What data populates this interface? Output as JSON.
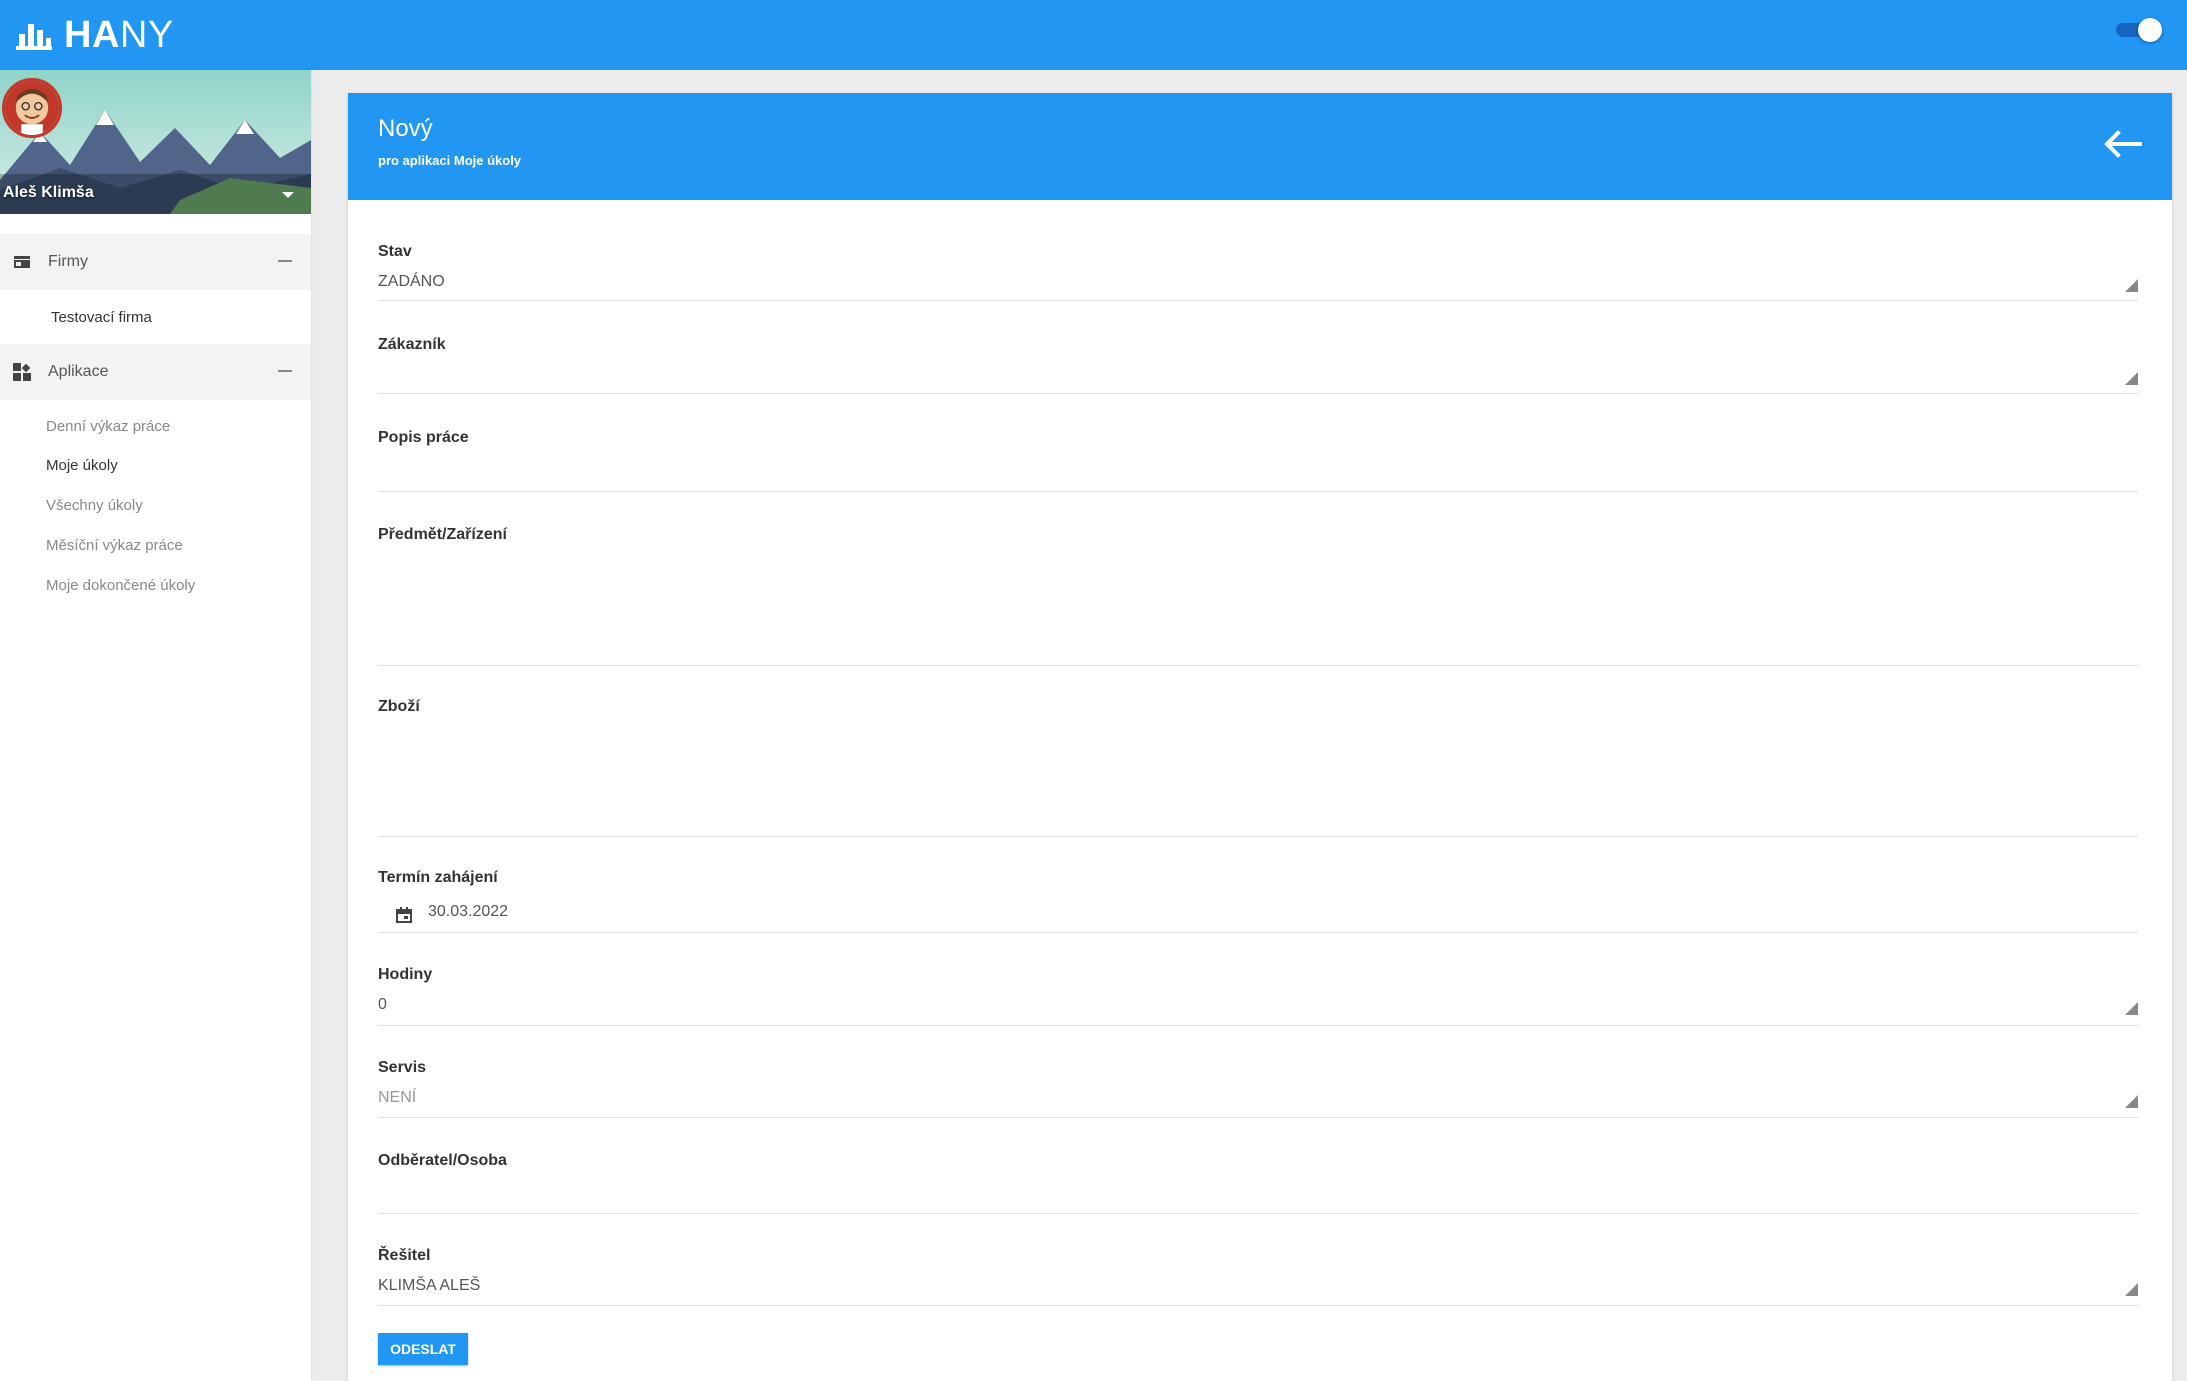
{
  "app": {
    "logo_bold": "HA",
    "logo_thin": "NY"
  },
  "user": {
    "name": "Aleš Klimša"
  },
  "sidebar": {
    "firmy": {
      "label": "Firmy",
      "items": [
        "Testovací firma"
      ]
    },
    "aplikace": {
      "label": "Aplikace",
      "items": [
        "Denní výkaz práce",
        "Moje úkoly",
        "Všechny úkoly",
        "Měsíční výkaz práce",
        "Moje dokončené úkoly"
      ],
      "active": "Moje úkoly"
    }
  },
  "panel": {
    "title": "Nový",
    "subtitle": "pro aplikaci Moje úkoly"
  },
  "form": {
    "stav": {
      "label": "Stav",
      "value": "ZADÁNO"
    },
    "zakaznik": {
      "label": "Zákazník",
      "value": ""
    },
    "popis": {
      "label": "Popis práce",
      "value": ""
    },
    "predmet": {
      "label": "Předmět/Zařízení",
      "value": ""
    },
    "zbozi": {
      "label": "Zboží",
      "value": ""
    },
    "termin": {
      "label": "Termín zahájení",
      "value": "30.03.2022"
    },
    "hodiny": {
      "label": "Hodiny",
      "value": "0"
    },
    "servis": {
      "label": "Servis",
      "value": "NENÍ"
    },
    "odberatel": {
      "label": "Odběratel/Osoba",
      "value": ""
    },
    "resitel": {
      "label": "Řešitel",
      "value": "KLIMŠA ALEŠ"
    },
    "submit_label": "ODESLAT"
  },
  "colors": {
    "primary": "#2196f3",
    "toggle_track": "#1565c0"
  }
}
